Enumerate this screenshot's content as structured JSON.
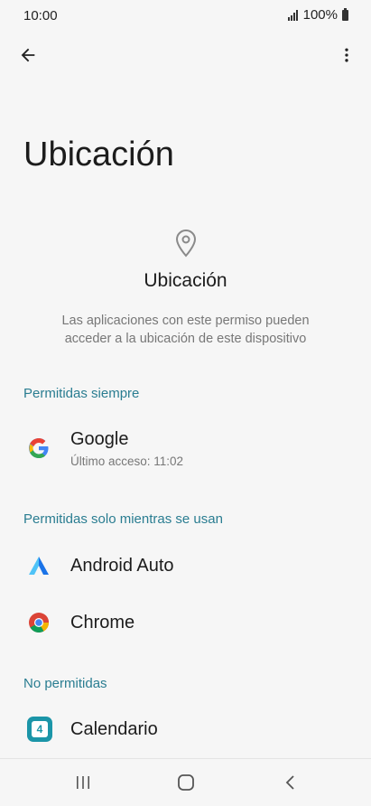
{
  "status": {
    "time": "10:00",
    "battery": "100%"
  },
  "toolbar": {
    "back_icon": "arrow-back-icon",
    "more_icon": "more-vert-icon"
  },
  "page": {
    "title": "Ubicación",
    "hero_title": "Ubicación",
    "hero_description": "Las aplicaciones con este permiso pueden acceder a la ubicación de este dispositivo"
  },
  "sections": {
    "always": {
      "header": "Permitidas siempre",
      "apps": [
        {
          "name": "Google",
          "subtitle": "Último acceso: 11:02"
        }
      ]
    },
    "while_using": {
      "header": "Permitidas solo mientras se usan",
      "apps": [
        {
          "name": "Android Auto"
        },
        {
          "name": "Chrome"
        }
      ]
    },
    "denied": {
      "header": "No permitidas",
      "apps": [
        {
          "name": "Calendario",
          "icon_label": "4"
        }
      ]
    }
  },
  "colors": {
    "accent": "#2a7d91",
    "background": "#f6f6f6"
  }
}
